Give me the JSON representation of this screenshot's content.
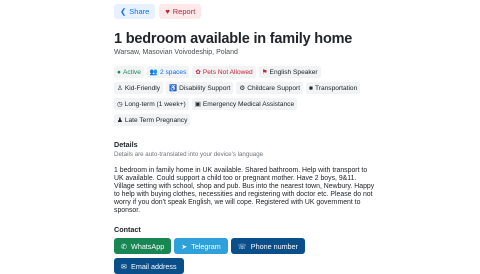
{
  "actions": {
    "share_label": "Share",
    "report_label": "Report"
  },
  "listing": {
    "title": "1 bedroom available in family home",
    "location": "Warsaw, Masovian Voivodeship, Poland"
  },
  "tags": [
    {
      "label": "Active",
      "icon": "dot-icon"
    },
    {
      "label": "2 spaces",
      "icon": "people-icon"
    },
    {
      "label": "Pets Not Allowed",
      "icon": "paw-icon"
    },
    {
      "label": "English Speaker",
      "icon": "flag-icon"
    },
    {
      "label": "Kid-Friendly",
      "icon": "child-icon"
    },
    {
      "label": "Disability Support",
      "icon": "wheelchair-icon"
    },
    {
      "label": "Childcare Support",
      "icon": "stroller-icon"
    },
    {
      "label": "Transportation",
      "icon": "car-icon"
    },
    {
      "label": "Long-term (1 week+)",
      "icon": "clock-icon"
    },
    {
      "label": "Emergency Medical Assistance",
      "icon": "medical-icon"
    },
    {
      "label": "Late Term Pregnancy",
      "icon": "pregnancy-icon"
    }
  ],
  "details": {
    "heading": "Details",
    "note": "Details are auto-translated into your device's language",
    "text": "1 bedroom in family home in UK available. Shared bathroom. Help with transport to UK available. Could support a child too or pregnant mother. Have 2 boys, 9&11. Village setting with school, shop and pub. Bus into the nearest town, Newbury. Happy to help with buying clothes, necessities and registering with doctor etc. Please do not worry if you don't speak English, we will cope. Registered with UK government to sponsor."
  },
  "contact": {
    "heading": "Contact",
    "whatsapp_label": "WhatsApp",
    "telegram_label": "Telegram",
    "phone_label": "Phone number",
    "email_label": "Email address"
  },
  "colors": {
    "active": "#198754",
    "spaces": "#0d6efd",
    "pets": "#c82333",
    "whatsapp": "#198754",
    "telegram": "#2ea0da",
    "primary": "#0b4f8a"
  }
}
